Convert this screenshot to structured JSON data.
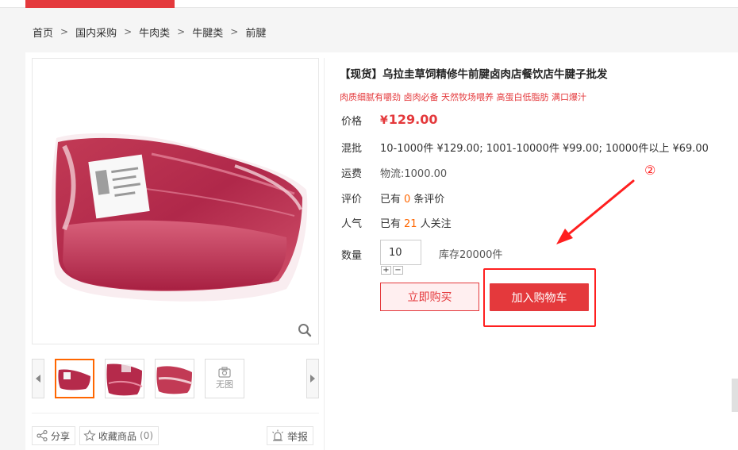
{
  "breadcrumb": [
    "首页",
    "国内采购",
    "牛肉类",
    "牛腱类",
    "前腱"
  ],
  "breadcrumb_sep": ">",
  "product": {
    "title": "【现货】乌拉圭草饲精修牛前腱卤肉店餐饮店牛腱子批发",
    "subtitle": "肉质细腻有嚼劲 卤肉必备 天然牧场喂养 高蛋白低脂肪 满口爆汁"
  },
  "price": {
    "label": "价格",
    "symbol": "¥",
    "value": "129.00"
  },
  "wholesale": {
    "label": "混批",
    "text": "10-1000件 ¥129.00; 1001-10000件 ¥99.00; 10000件以上 ¥69.00"
  },
  "shipping": {
    "label": "运费",
    "text": "物流:1000.00"
  },
  "reviews": {
    "label": "评价",
    "prefix": "已有",
    "count": "0",
    "suffix": "条评价"
  },
  "popularity": {
    "label": "人气",
    "prefix": "已有",
    "count": "21",
    "suffix": "人关注"
  },
  "quantity": {
    "label": "数量",
    "value": "10",
    "plus": "+",
    "minus": "−",
    "stock": "库存20000件"
  },
  "actions": {
    "buy_now": "立即购买",
    "add_to_cart": "加入购物车"
  },
  "thumbnails": {
    "no_image": "无图"
  },
  "footer": {
    "share": "分享",
    "favorite": "收藏商品",
    "favorite_count": "(0)",
    "report": "举报"
  },
  "annotation": {
    "step": "②"
  },
  "colors": {
    "accent": "#e4393c",
    "highlight": "#ff6600",
    "annotation": "#ff1f1f"
  }
}
